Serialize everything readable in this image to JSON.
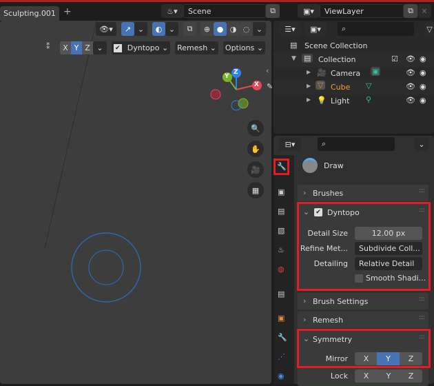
{
  "header": {
    "workspace_tab": "Sculpting.001",
    "add_tab": "+",
    "scene": "Scene",
    "view_layer": "ViewLayer"
  },
  "viewport": {
    "axis_buttons": [
      "X",
      "Y",
      "Z"
    ],
    "active_axis": "Y",
    "dyntopo": "Dyntopo",
    "dyntopo_checked": true,
    "remesh": "Remesh",
    "options": "Options",
    "gizmo": {
      "x": "X",
      "y": "Y",
      "z": "Z"
    }
  },
  "outliner": {
    "scene_collection": "Scene Collection",
    "collection": "Collection",
    "items": [
      {
        "name": "Camera",
        "color": "#dddddd"
      },
      {
        "name": "Cube",
        "color": "#f0a030"
      },
      {
        "name": "Light",
        "color": "#dddddd"
      }
    ]
  },
  "properties": {
    "tool_name": "Draw",
    "panels": {
      "brushes": "Brushes",
      "dyntopo": "Dyntopo",
      "brush_settings": "Brush Settings",
      "remesh": "Remesh",
      "symmetry": "Symmetry"
    },
    "dyntopo": {
      "detail_size_label": "Detail Size",
      "detail_size": "12.00 px",
      "refine_label": "Refine Met...",
      "refine": "Subdivide Coll...",
      "detailing_label": "Detailing",
      "detailing": "Relative Detail",
      "smooth": "Smooth Shadi...",
      "smooth_checked": false
    },
    "symmetry": {
      "mirror_label": "Mirror",
      "lock_label": "Lock",
      "axes": [
        "X",
        "Y",
        "Z"
      ],
      "mirror_active": "Y"
    }
  },
  "colors": {
    "accent": "#4772b3",
    "highlight": "#e01f25"
  }
}
